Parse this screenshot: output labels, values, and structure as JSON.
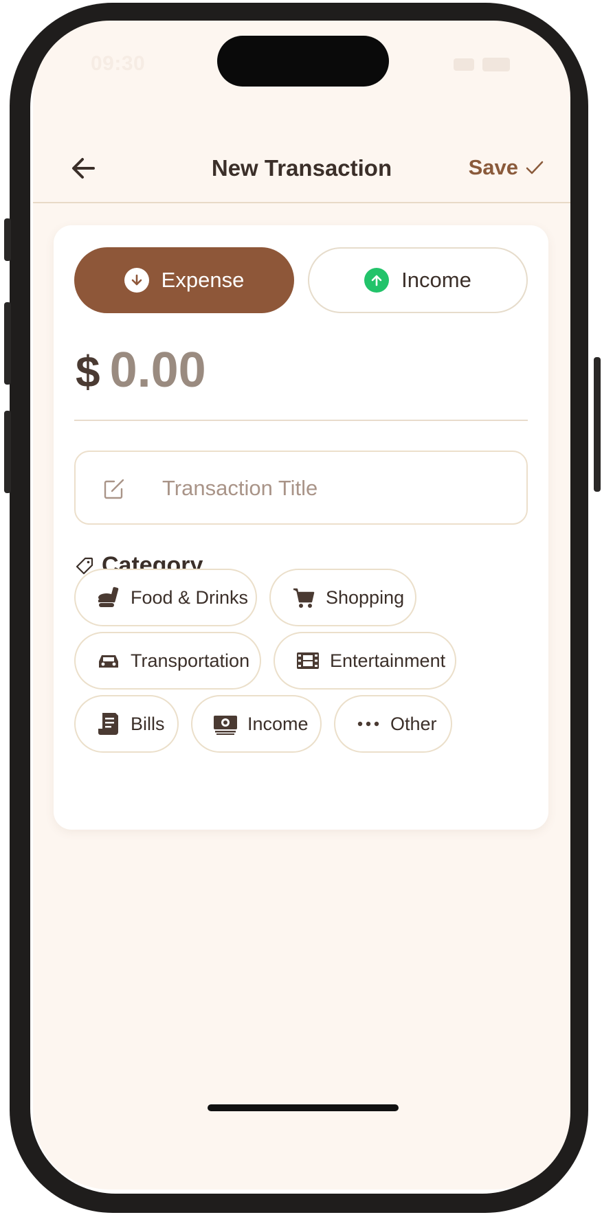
{
  "status": {
    "time": "09:30"
  },
  "header": {
    "title": "New Transaction",
    "save_label": "Save"
  },
  "type_toggle": {
    "expense_label": "Expense",
    "income_label": "Income",
    "selected": "Expense"
  },
  "amount": {
    "currency": "$",
    "value": "0.00"
  },
  "title_field": {
    "placeholder": "Transaction Title",
    "value": ""
  },
  "category": {
    "heading": "Category",
    "items": [
      {
        "label": "Food & Drinks",
        "icon": "food-drinks-icon"
      },
      {
        "label": "Shopping",
        "icon": "cart-icon"
      },
      {
        "label": "Transportation",
        "icon": "car-icon"
      },
      {
        "label": "Entertainment",
        "icon": "film-icon"
      },
      {
        "label": "Bills",
        "icon": "receipt-icon"
      },
      {
        "label": "Income",
        "icon": "money-icon"
      },
      {
        "label": "Other",
        "icon": "ellipsis-icon"
      }
    ]
  },
  "colors": {
    "primary": "#8e5739",
    "background": "#fdf6f0",
    "income_accent": "#22c36a",
    "text": "#3b2f29",
    "muted": "#9a8b80"
  }
}
